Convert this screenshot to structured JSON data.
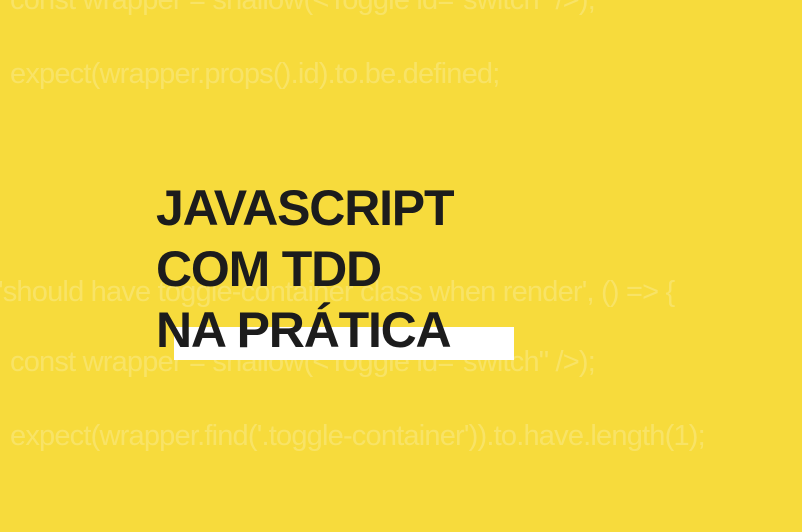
{
  "background": {
    "color": "#f7db3c",
    "code_lines": [
      "const wrapper = shallow(<Toggle id=\"switch\" />);",
      "expect(wrapper.props().id).to.be.defined;",
      "'should have toggle-container class when render', () => {",
      "const wrapper = shallow(<Toggle id=\"switch\" />);",
      "expect(wrapper.find('.toggle-container')).to.have.length(1);"
    ]
  },
  "title": {
    "lines": [
      "JAVASCRIPT",
      "COM TDD",
      "NA PRÁTICA"
    ],
    "color": "#1c1c1c",
    "underline_color": "#ffffff"
  }
}
